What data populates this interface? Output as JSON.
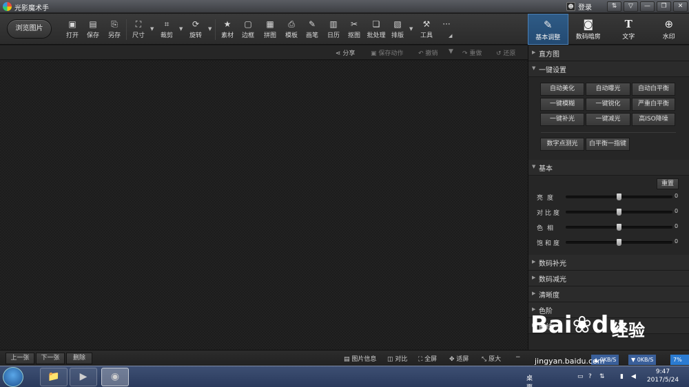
{
  "title_bar": {
    "app_title": "光影魔术手",
    "login_label": "登录",
    "window_buttons": [
      "⇅",
      "▽",
      "—",
      "❐",
      "✕"
    ]
  },
  "toolbar": {
    "browse_label": "浏览图片",
    "tools": [
      {
        "label": "打开",
        "icon": "open-image-icon",
        "glyph": "▣"
      },
      {
        "label": "保存",
        "icon": "save-icon",
        "glyph": "▤"
      },
      {
        "label": "另存",
        "icon": "save-as-icon",
        "glyph": "⎘"
      },
      {
        "label": "尺寸",
        "icon": "resize-icon",
        "glyph": "⛶"
      },
      {
        "label": "裁剪",
        "icon": "crop-icon",
        "glyph": "⌗"
      },
      {
        "label": "旋转",
        "icon": "rotate-icon",
        "glyph": "⟳"
      },
      {
        "label": "素材",
        "icon": "material-icon",
        "glyph": "★"
      },
      {
        "label": "边框",
        "icon": "border-icon",
        "glyph": "▢"
      },
      {
        "label": "拼图",
        "icon": "collage-icon",
        "glyph": "▦"
      },
      {
        "label": "模板",
        "icon": "template-icon",
        "glyph": "⎙"
      },
      {
        "label": "画笔",
        "icon": "brush-icon",
        "glyph": "✎"
      },
      {
        "label": "日历",
        "icon": "calendar-icon",
        "glyph": "▥"
      },
      {
        "label": "抠图",
        "icon": "cutout-icon",
        "glyph": "✂"
      },
      {
        "label": "批处理",
        "icon": "batch-icon",
        "glyph": "❏"
      },
      {
        "label": "排版",
        "icon": "layout-icon",
        "glyph": "▧"
      },
      {
        "label": "工具",
        "icon": "wrench-icon",
        "glyph": "🔧"
      }
    ],
    "more_label": "···"
  },
  "panel_tabs": [
    {
      "label": "基本调整",
      "icon": "adjust-icon",
      "glyph": "✎",
      "active": true
    },
    {
      "label": "数码暗房",
      "icon": "camera-icon",
      "glyph": "◙",
      "active": false
    },
    {
      "label": "文字",
      "icon": "text-icon",
      "glyph": "T",
      "active": false
    },
    {
      "label": "水印",
      "icon": "watermark-icon",
      "glyph": "⊕",
      "active": false
    }
  ],
  "action_bar": {
    "share": "分享",
    "save_action": "保存动作",
    "undo": "撤销",
    "redo": "重做",
    "restore": "还原"
  },
  "panel": {
    "histogram": "直方图",
    "one_click": "一键设置",
    "one_click_buttons": [
      "自动美化",
      "自动曝光",
      "自动白平衡",
      "一键模糊",
      "一键锐化",
      "严重白平衡",
      "一键补光",
      "一键减光",
      "高ISO降噪"
    ],
    "extra_buttons": [
      "数字点测光",
      "白平衡一指键"
    ],
    "basic": "基本",
    "reset": "重置",
    "sliders": [
      {
        "name": "亮度",
        "value": "0",
        "level": 0.5
      },
      {
        "name": "对比度",
        "value": "0",
        "level": 0.5
      },
      {
        "name": "色相",
        "value": "0",
        "level": 0.5
      },
      {
        "name": "饱和度",
        "value": "0",
        "level": 0.5
      }
    ],
    "more_sections": [
      "数码补光",
      "数码减光",
      "清晰度",
      "色阶",
      "曲线"
    ]
  },
  "bottom_bar": {
    "prev": "上一张",
    "next": "下一张",
    "delete": "删除",
    "info": "图片信息",
    "compare": "对比",
    "fullscreen": "全屏",
    "fit": "适屏",
    "original": "原大",
    "zoom_minus": "−"
  },
  "status": {
    "up_speed": "0KB/S",
    "down_speed": "0KB/S",
    "cpu": "7%"
  },
  "taskbar": {
    "desktop_label": "桌面",
    "time": "9:47",
    "date": "2017/5/24"
  },
  "watermark": {
    "brand": "Bai",
    "brand2": "du",
    "brand_cn": "经验",
    "url": "jingyan.baidu.com"
  }
}
